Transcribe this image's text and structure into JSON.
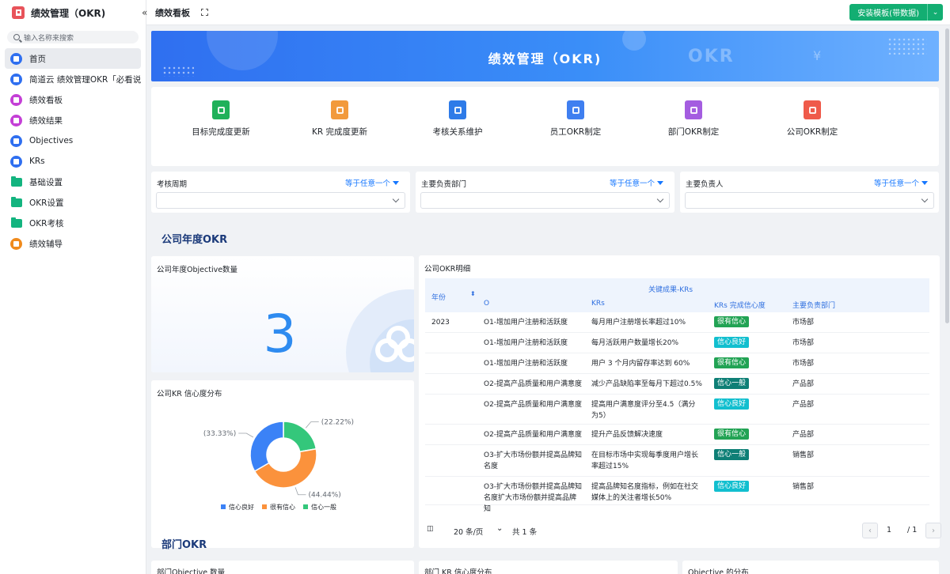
{
  "app": {
    "title": "绩效管理（OKR)"
  },
  "search": {
    "placeholder": "输入名称来搜索"
  },
  "sidebar": {
    "items": [
      {
        "label": "首页",
        "icon": "home-icon",
        "color": "#2f6ff0"
      },
      {
        "label": "简道云 绩效管理OKR「必看说…",
        "icon": "doc-icon",
        "color": "#2f6ff0"
      },
      {
        "label": "绩效看板",
        "icon": "dashboard-icon",
        "color": "#c43fd6"
      },
      {
        "label": "绩效结果",
        "icon": "result-icon",
        "color": "#c43fd6"
      },
      {
        "label": "Objectives",
        "icon": "target-icon",
        "color": "#2f6ff0"
      },
      {
        "label": "KRs",
        "icon": "bookmark-icon",
        "color": "#2f6ff0"
      },
      {
        "label": "基础设置",
        "icon": "folder-icon",
        "color": "#13b47f"
      },
      {
        "label": "OKR设置",
        "icon": "folder-icon",
        "color": "#13b47f"
      },
      {
        "label": "OKR考核",
        "icon": "folder-icon",
        "color": "#13b47f"
      },
      {
        "label": "绩效辅导",
        "icon": "coach-icon",
        "color": "#f08a1c"
      }
    ]
  },
  "topbar": {
    "tab_title": "绩效看板",
    "install_label": "安装模板(带数据)"
  },
  "banner": {
    "title": "绩效管理（OKR)",
    "watermark": "OKR",
    "symbol": "¥"
  },
  "quick_links": [
    {
      "label": "目标完成度更新",
      "icon": "goal-update-icon",
      "color": "#20b15a"
    },
    {
      "label": "KR 完成度更新",
      "icon": "kr-update-icon",
      "color": "#f29a3c"
    },
    {
      "label": "考核关系维护",
      "icon": "relation-icon",
      "color": "#2e7be8"
    },
    {
      "label": "员工OKR制定",
      "icon": "employee-okr-icon",
      "color": "#3f7ff0"
    },
    {
      "label": "部门OKR制定",
      "icon": "dept-okr-icon",
      "color": "#a45de0"
    },
    {
      "label": "公司OKR制定",
      "icon": "company-okr-icon",
      "color": "#ef5a4a"
    }
  ],
  "filters": [
    {
      "label": "考核周期",
      "operator": "等于任意一个"
    },
    {
      "label": "主要负责部门",
      "operator": "等于任意一个"
    },
    {
      "label": "主要负责人",
      "operator": "等于任意一个"
    }
  ],
  "company_section": {
    "title": "公司年度OKR"
  },
  "objective_card": {
    "title": "公司年度Objective数量",
    "value": "3"
  },
  "kr_confidence_card": {
    "title": "公司KR 信心度分布"
  },
  "chart_data": {
    "type": "pie",
    "donut": true,
    "categories": [
      "信心良好",
      "很有信心",
      "信心一般"
    ],
    "values": [
      33.33,
      44.44,
      22.22
    ],
    "labels": [
      "(33.33%)",
      "(44.44%)",
      "(22.22%)"
    ],
    "colors": [
      "#3b82f6",
      "#fb923c",
      "#34c77b"
    ],
    "legend": "bottom"
  },
  "okr_table": {
    "title": "公司OKR明细",
    "group_header": "关键成果-KRs",
    "headers": {
      "year": "年份",
      "o": "O",
      "krs": "KRs",
      "confidence": "KRs 完成信心度",
      "dept": "主要负责部门"
    },
    "year": "2023",
    "rows": [
      {
        "o": "O1-增加用户注册和活跃度",
        "kr": "每月用户注册增长率超过10%",
        "confidence": "很有信心",
        "dept": "市场部"
      },
      {
        "o": "O1-增加用户注册和活跃度",
        "kr": "每月活跃用户数量增长20%",
        "confidence": "信心良好",
        "dept": "市场部"
      },
      {
        "o": "O1-增加用户注册和活跃度",
        "kr": "用户 3 个月内留存率达到 60%",
        "confidence": "很有信心",
        "dept": "市场部"
      },
      {
        "o": "O2-提高产品质量和用户满意度",
        "kr": "减少产品缺陷率至每月下超过0.5%",
        "confidence": "信心一般",
        "dept": "产品部"
      },
      {
        "o": "O2-提高产品质量和用户满意度",
        "kr": "提高用户满意度评分至4.5（满分为5）",
        "confidence": "信心良好",
        "dept": "产品部"
      },
      {
        "o": "O2-提高产品质量和用户满意度",
        "kr": "提升产品反馈解决速度",
        "confidence": "很有信心",
        "dept": "产品部"
      },
      {
        "o": "O3-扩大市场份额并提高品牌知名度",
        "kr": "在目标市场中实现每季度用户增长率超过15%",
        "confidence": "信心一般",
        "dept": "销售部"
      },
      {
        "o": "O3-扩大市场份额并提高品牌知名度扩大市场份额并提高品牌知",
        "kr": "提高品牌知名度指标，例如在社交媒体上的关注者增长50%",
        "confidence": "信心良好",
        "dept": "销售部"
      }
    ],
    "confidence_colors": {
      "很有信心": "#22a354",
      "信心良好": "#12bfcf",
      "信心一般": "#0e7f76"
    }
  },
  "pagination": {
    "page_size": "20 条/页",
    "total": "共 1 条",
    "current": "1",
    "total_pages": "/ 1"
  },
  "dept_section": {
    "title": "部门OKR"
  },
  "bottom_cards": [
    {
      "title": "部门Objective 数量"
    },
    {
      "title": "部门 KR 信心度分布"
    },
    {
      "title": "Objective 的分布"
    }
  ]
}
